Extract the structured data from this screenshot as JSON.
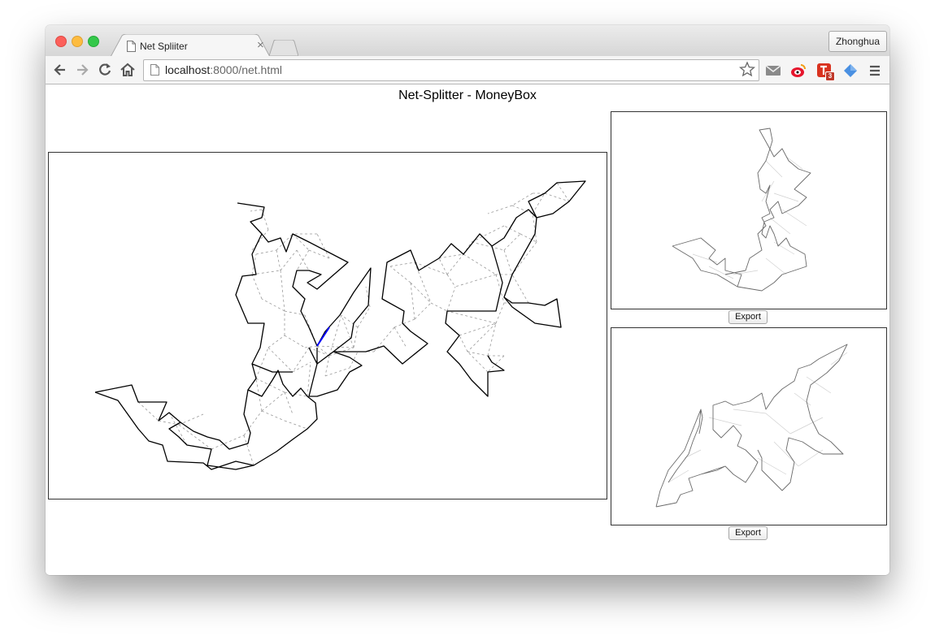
{
  "window": {
    "tab_title": "Net Spliiter",
    "profile_name": "Zhonghua"
  },
  "address_bar": {
    "host": "localhost",
    "rest": ":8000/net.html"
  },
  "extensions": [
    {
      "name": "mail-icon"
    },
    {
      "name": "weibo-icon"
    },
    {
      "name": "todo-icon",
      "badge": "3"
    },
    {
      "name": "diamond-icon"
    }
  ],
  "page": {
    "title": "Net-Splitter - MoneyBox",
    "export_label_1": "Export",
    "export_label_2": "Export"
  },
  "colors": {
    "net_outline": "#000000",
    "fold_lines": "#999999",
    "selected_edge": "#0000ff",
    "preview_outline": "#777777"
  }
}
